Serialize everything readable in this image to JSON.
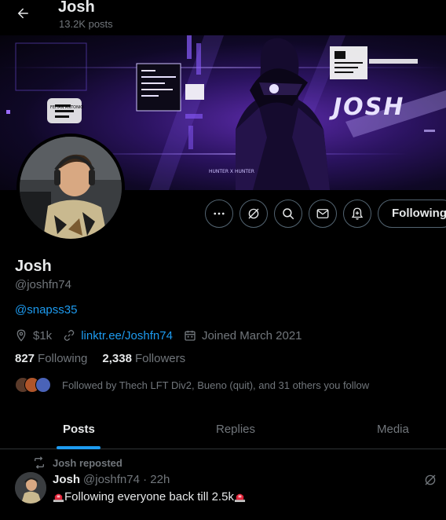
{
  "header": {
    "title": "Josh",
    "posts_count": "13.2K posts"
  },
  "banner": {
    "brand_text": "JOSH",
    "tag_text": "FEITAN ANTONIO",
    "subtitle_text": "HUNTER X HUNTER"
  },
  "actions": {
    "follow_label": "Following"
  },
  "profile": {
    "name": "Josh",
    "handle": "@joshfn74",
    "bio_link": "@snapss35",
    "location": "$1k",
    "website": "linktr.ee/Joshfn74",
    "joined": "Joined March 2021",
    "following_count": "827",
    "following_label": "Following",
    "followers_count": "2,338",
    "followers_label": "Followers",
    "followed_by": "Followed by Thech LFT Div2, Bueno (quit), and 31 others you follow"
  },
  "tabs": [
    "Posts",
    "Replies",
    "Media"
  ],
  "post": {
    "repost_label": "Josh reposted",
    "author": "Josh",
    "meta": "@joshfn74 · 22h",
    "text": "Following everyone back till 2.5k"
  },
  "colors": {
    "accent": "#1d9bf0",
    "background": "#000000",
    "muted": "#71767b",
    "text": "#e7e9ea",
    "border": "#536471"
  }
}
